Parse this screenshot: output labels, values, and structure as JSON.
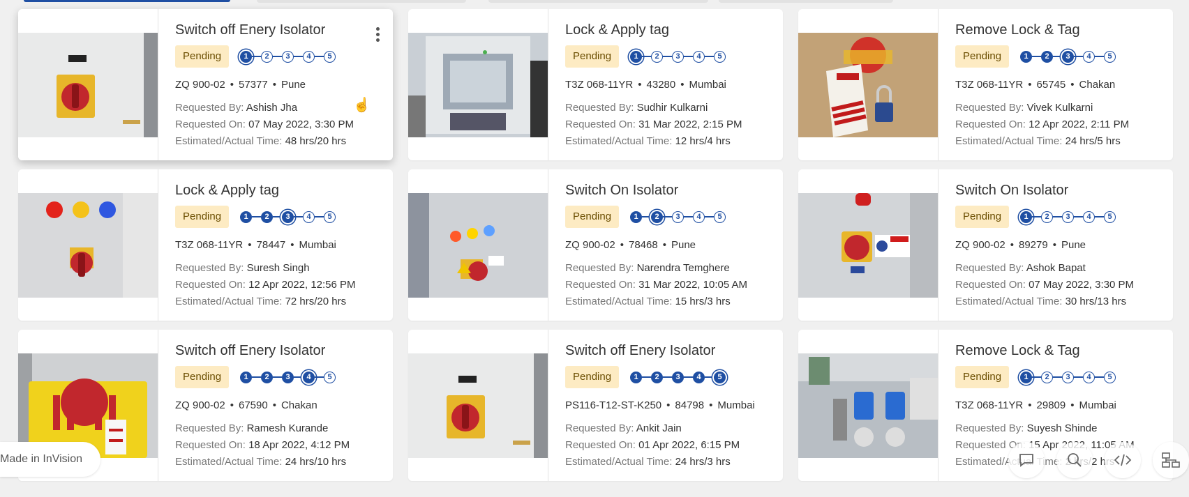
{
  "labels": {
    "requested_by": "Requested By: ",
    "requested_on": "Requested On: ",
    "estimated_time": "Estimated/Actual Time: "
  },
  "cards": [
    {
      "title": "Switch off Enery Isolator",
      "status": "Pending",
      "current_step": 1,
      "code": "ZQ 900-02",
      "id": "57377",
      "location": "Pune",
      "requested_by": "Ashish Jha",
      "requested_on": "07 May 2022, 3:30 PM",
      "time": "48 hrs/20 hrs",
      "image": "panel-isolator-switch"
    },
    {
      "title": "Lock & Apply tag",
      "status": "Pending",
      "current_step": 1,
      "code": "T3Z 068-11YR",
      "id": "43280",
      "location": "Mumbai",
      "requested_by": "Sudhir Kulkarni",
      "requested_on": "31 Mar 2022, 2:15 PM",
      "time": "12 hrs/4 hrs",
      "image": "machine-cabinet"
    },
    {
      "title": "Remove Lock & Tag",
      "status": "Pending",
      "current_step": 3,
      "code": "T3Z 068-11YR",
      "id": "65745",
      "location": "Chakan",
      "requested_by": "Vivek Kulkarni",
      "requested_on": "12 Apr 2022, 2:11 PM",
      "time": "24 hrs/5 hrs",
      "image": "danger-tag-lock"
    },
    {
      "title": "Lock & Apply tag",
      "status": "Pending",
      "current_step": 3,
      "code": "T3Z 068-11YR",
      "id": "78447",
      "location": "Mumbai",
      "requested_by": "Suresh Singh",
      "requested_on": "12 Apr 2022, 12:56 PM",
      "time": "72 hrs/20 hrs",
      "image": "panel-lights"
    },
    {
      "title": "Switch On Isolator",
      "status": "Pending",
      "current_step": 2,
      "code": "ZQ 900-02",
      "id": "78468",
      "location": "Pune",
      "requested_by": "Narendra Temghere",
      "requested_on": "31 Mar 2022, 10:05 AM",
      "time": "15 hrs/3 hrs",
      "image": "panel-lights-side"
    },
    {
      "title": "Switch On Isolator",
      "status": "Pending",
      "current_step": 1,
      "code": "ZQ 900-02",
      "id": "89279",
      "location": "Pune",
      "requested_by": "Ashok Bapat",
      "requested_on": "07 May 2022, 3:30 PM",
      "time": "30 hrs/13 hrs",
      "image": "panel-danger-sign"
    },
    {
      "title": "Switch off Enery Isolator",
      "status": "Pending",
      "current_step": 4,
      "code": "ZQ 900-02",
      "id": "67590",
      "location": "Chakan",
      "requested_by": "Ramesh Kurande",
      "requested_on": "18 Apr 2022, 4:12 PM",
      "time": "24 hrs/10 hrs",
      "image": "lockout-box"
    },
    {
      "title": "Switch off Enery Isolator",
      "status": "Pending",
      "current_step": 5,
      "code": "PS116-T12-ST-K250",
      "id": "84798",
      "location": "Mumbai",
      "requested_by": "Ankit Jain",
      "requested_on": "01 Apr 2022, 6:15 PM",
      "time": "24 hrs/3 hrs",
      "image": "panel-isolator-switch"
    },
    {
      "title": "Remove Lock & Tag",
      "status": "Pending",
      "current_step": 1,
      "code": "T3Z 068-11YR",
      "id": "29809",
      "location": "Mumbai",
      "requested_by": "Suyesh Shinde",
      "requested_on": "15 Apr 2022, 11:05 AM",
      "time": "2 hrs/2 hrs",
      "image": "pneumatic-valves"
    }
  ],
  "steps": [
    "1",
    "2",
    "3",
    "4",
    "5"
  ],
  "footer": {
    "made_in": "Made in InVision",
    "tools": [
      "comment-icon",
      "search-icon",
      "code-icon",
      "sitemap-icon"
    ]
  },
  "colors": {
    "accent": "#1f4fa3",
    "badge_bg": "#fdebc3"
  }
}
